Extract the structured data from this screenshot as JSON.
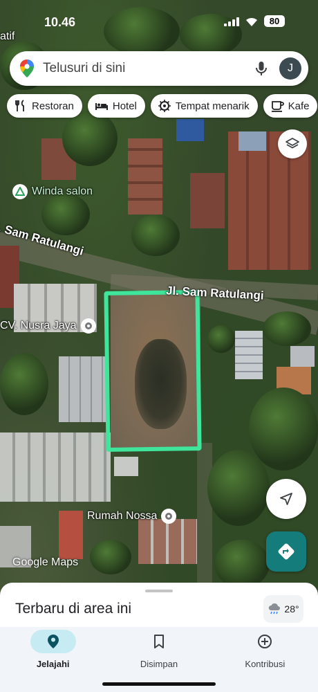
{
  "status_bar": {
    "time": "10.46",
    "battery": "80"
  },
  "search": {
    "placeholder": "Telusuri di sini",
    "avatar_initial": "J"
  },
  "chips": [
    {
      "label": "Restoran",
      "icon": "restaurant-icon"
    },
    {
      "label": "Hotel",
      "icon": "hotel-icon"
    },
    {
      "label": "Tempat menarik",
      "icon": "attraction-icon"
    },
    {
      "label": "Kafe",
      "icon": "cafe-icon"
    }
  ],
  "map": {
    "labels": {
      "top_left_fragment": "atif",
      "salon": "Winda salon",
      "road_left": "l. Sam Ratulangi",
      "road_right": "Jl. Sam Ratulangi",
      "place_nusra": "CV. Nusra Jaya",
      "place_nossa": "Rumah Nossa",
      "attribution": "Google Maps"
    },
    "highlight_color": "#3ee59a"
  },
  "sheet": {
    "title": "Terbaru di area ini",
    "weather": "28°"
  },
  "nav": [
    {
      "label": "Jelajahi",
      "icon": "explore-pin-icon",
      "active": true
    },
    {
      "label": "Disimpan",
      "icon": "bookmark-icon",
      "active": false
    },
    {
      "label": "Kontribusi",
      "icon": "add-circle-icon",
      "active": false
    }
  ],
  "colors": {
    "directions_button": "#147c7a",
    "active_nav_pill": "#c7ebf2"
  }
}
